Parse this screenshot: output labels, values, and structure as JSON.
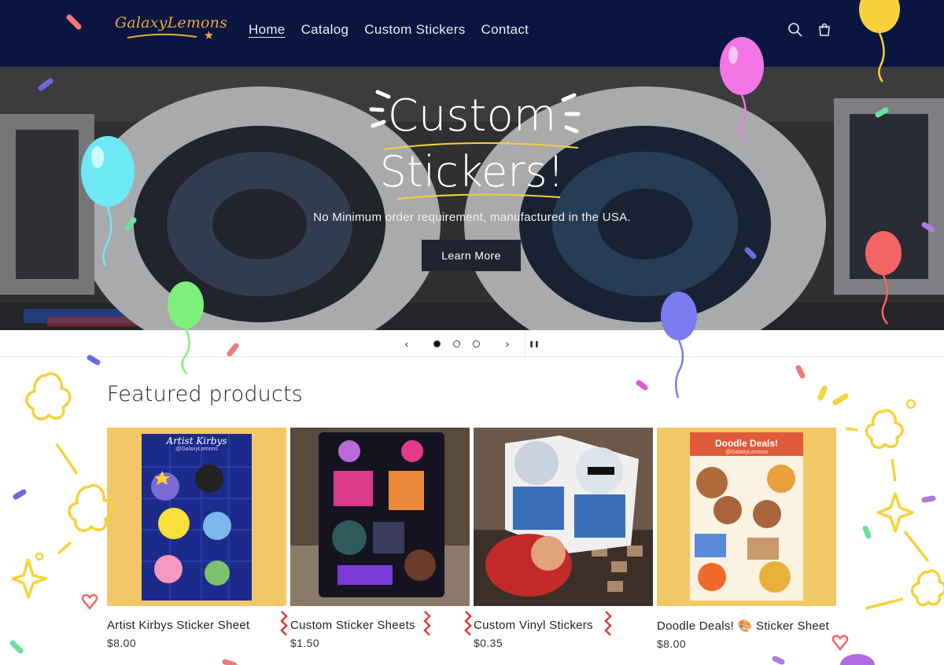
{
  "brand": {
    "logo_text": "GalaxyLemons"
  },
  "nav": {
    "items": [
      "Home",
      "Catalog",
      "Custom Stickers",
      "Contact"
    ],
    "active": "Home"
  },
  "header_icons": [
    "search-icon",
    "cart-icon"
  ],
  "hero": {
    "title_line1": "Custom",
    "title_line2": "Stickers!",
    "subtitle": "No Minimum order requirement, manufactured in the USA.",
    "button": "Learn More"
  },
  "slider": {
    "slides": 3,
    "current": 1,
    "prev": "‹",
    "next": "›",
    "pause": "❚❚"
  },
  "featured": {
    "heading": "Featured products",
    "products": [
      {
        "name": "Artist Kirbys Sticker Sheet",
        "price": "$8.00",
        "image_label": "Artist Kirbys",
        "image_sub": "@GalaxyLemons"
      },
      {
        "name": "Custom Sticker Sheets",
        "price": "$1.50"
      },
      {
        "name": "Custom Vinyl Stickers",
        "price": "$0.35"
      },
      {
        "name": "Doodle Deals! 🎨 Sticker Sheet",
        "price": "$8.00",
        "image_label": "Doodle Deals!",
        "image_sub": "@GalaxyLemons"
      }
    ]
  },
  "colors": {
    "header_bg": "#0b1640",
    "logo": "#e6a93a",
    "card_bg": "#f2c767",
    "button_bg": "#1f2430"
  }
}
